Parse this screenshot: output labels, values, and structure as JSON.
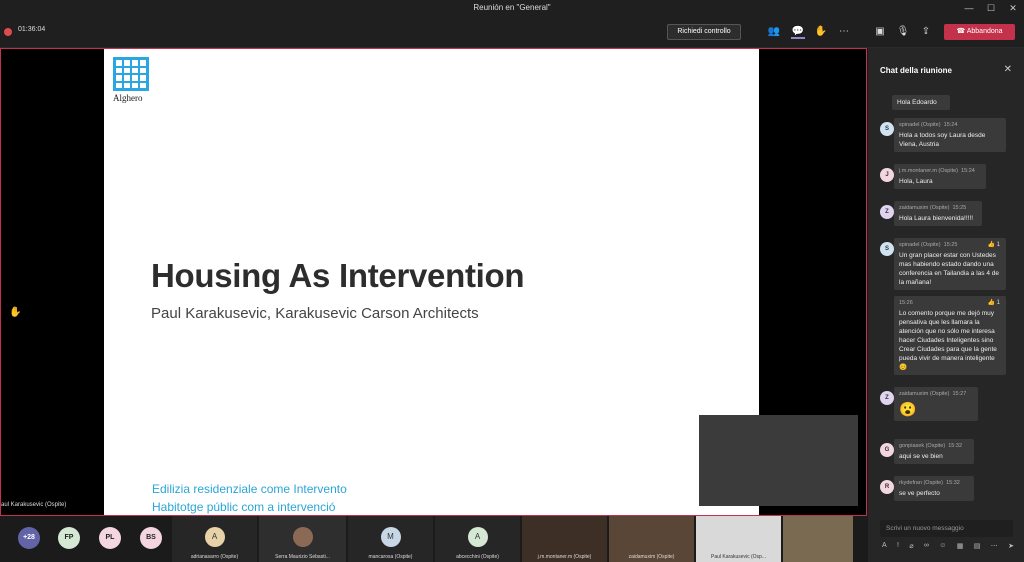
{
  "window": {
    "title": "Reunión en \"General\""
  },
  "toolbar": {
    "recording_time": "01:36:04",
    "request_control": "Richiedi controllo",
    "leave": "Abbandona",
    "icons": [
      "people-icon",
      "chat-icon",
      "raise-hand-icon",
      "more-icon",
      "camera-icon",
      "mic-off-icon",
      "share-icon"
    ]
  },
  "slide": {
    "logo_text": "Alghero",
    "title": "Housing As Intervention",
    "subtitle": "Paul Karakusevic, Karakusevic Carson Architects",
    "footer_line1": "Edilizia residenziale come Intervento",
    "footer_line2": "Habitotge públic com a intervenció"
  },
  "stage": {
    "presenter_label": "aul Karakusevic (Ospite)"
  },
  "participants": {
    "more_count": "+28",
    "bubbles": [
      "FP",
      "PL",
      "BS"
    ],
    "tiles": [
      {
        "initial": "A",
        "name": "adrianasarro (Ospite)"
      },
      {
        "initial": "",
        "name": "Serra Maurizio Sebasti..."
      },
      {
        "initial": "M",
        "name": "mancarosa (Ospite)"
      },
      {
        "initial": "A",
        "name": "abcecchini (Ospite)"
      },
      {
        "initial": "",
        "name": "j.m.montaner.m (Ospite)"
      },
      {
        "initial": "",
        "name": "zaidamuxim (Ospite)"
      },
      {
        "initial": "",
        "name": "Paul Karakusevic (Osp..."
      },
      {
        "initial": "",
        "name": ""
      }
    ]
  },
  "chat": {
    "title": "Chat della riunione",
    "messages": [
      {
        "text": "Hola Edoardo"
      },
      {
        "initial": "S",
        "author": "spinadel (Ospite)",
        "time": "15:24",
        "text": "Hola a todos soy Laura desde Viena, Austria"
      },
      {
        "initial": "J",
        "author": "j.m.montaner.m (Ospite)",
        "time": "15:24",
        "text": "Hola, Laura"
      },
      {
        "initial": "Z",
        "author": "zaidamuxim (Ospite)",
        "time": "15:25",
        "text": "Hola Laura bienvenida!!!!!"
      },
      {
        "initial": "S",
        "author": "spinadel (Ospite)",
        "time": "15:25",
        "reaction": "👍 1",
        "text": "Un gran placer estar con Ustedes mas habiendo estado dando una conferencia en Tailandia a las 4 de la mañana!"
      },
      {
        "time": "15:26",
        "reaction": "👍 1",
        "text": "Lo comento porque me dejó muy pensativa que les llamara la atención que no sólo me interesa hacer Ciudades Inteligentes sino Crear Ciudades para que la gente pueda vivir de manera inteligente 😊"
      },
      {
        "initial": "Z",
        "author": "zaidamuxim (Ospite)",
        "time": "15:27",
        "text": "😮"
      },
      {
        "initial": "G",
        "author": "gonpiasek (Ospite)",
        "time": "15:32",
        "text": "aqui se ve bien"
      },
      {
        "initial": "R",
        "author": "rkydefran (Ospite)",
        "time": "15:32",
        "text": "se ve perfecto"
      }
    ],
    "input_placeholder": "Scrivi un nuovo messaggio"
  },
  "colors": {
    "accent": "#8b8cc7",
    "leave": "#c4314b",
    "slide_blue": "#2aa6d6"
  }
}
